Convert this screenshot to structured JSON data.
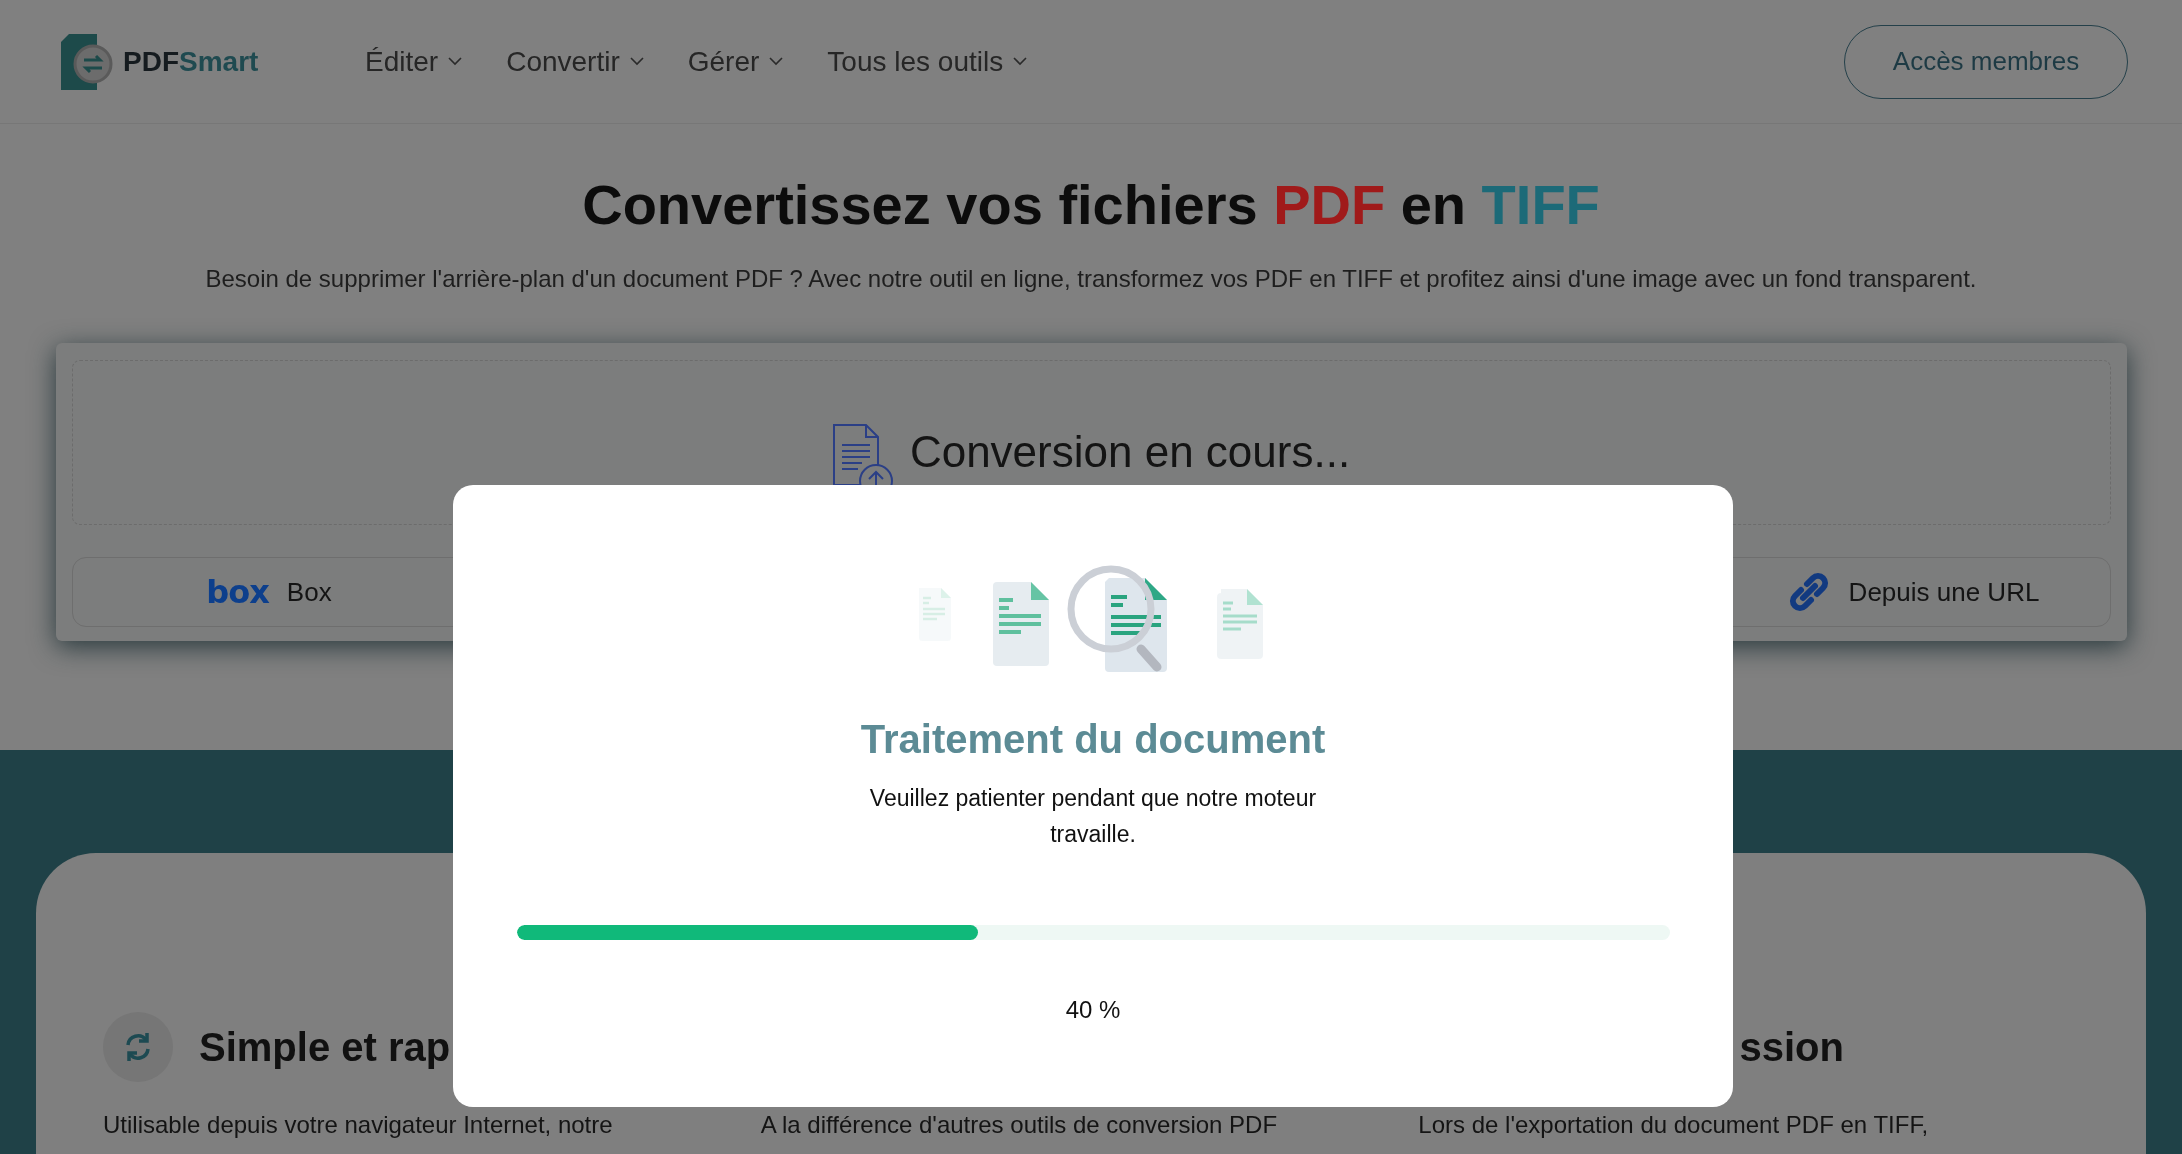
{
  "header": {
    "logo": {
      "part_1": "PDF",
      "part_2": "Smart"
    },
    "nav": [
      {
        "label": "Éditer"
      },
      {
        "label": "Convertir"
      },
      {
        "label": "Gérer"
      },
      {
        "label": "Tous les outils"
      }
    ],
    "member_button": "Accès membres"
  },
  "hero": {
    "title_parts": [
      {
        "text": "Convertissez vos fichiers ",
        "kind": "plain"
      },
      {
        "text": "PDF",
        "kind": "source"
      },
      {
        "text": " en ",
        "kind": "plain"
      },
      {
        "text": "TIFF",
        "kind": "target"
      }
    ],
    "subtitle": "Besoin de supprimer l'arrière-plan d'un document PDF ? Avec notre outil en ligne, transformez vos PDF en TIFF et profitez ainsi d'une image avec un fond transparent."
  },
  "converter": {
    "status": "Conversion en cours...",
    "sources": [
      {
        "kind": "box",
        "logo_text": "box",
        "label": "Box"
      },
      {
        "kind": "url",
        "label": "Depuis une URL"
      }
    ]
  },
  "features": [
    {
      "title": "Simple et rap",
      "text": "Utilisable depuis votre navigateur Internet, notre"
    },
    {
      "text": "A la différence d'autres outils de conversion PDF"
    },
    {
      "title": "ssion",
      "text": "Lors de l'exportation du document PDF en TIFF,"
    }
  ],
  "dialog": {
    "title": "Traitement du document",
    "message": "Veuillez patienter pendant que notre moteur travaille.",
    "progress": {
      "level": 0.4
    },
    "reading": "40 %"
  }
}
